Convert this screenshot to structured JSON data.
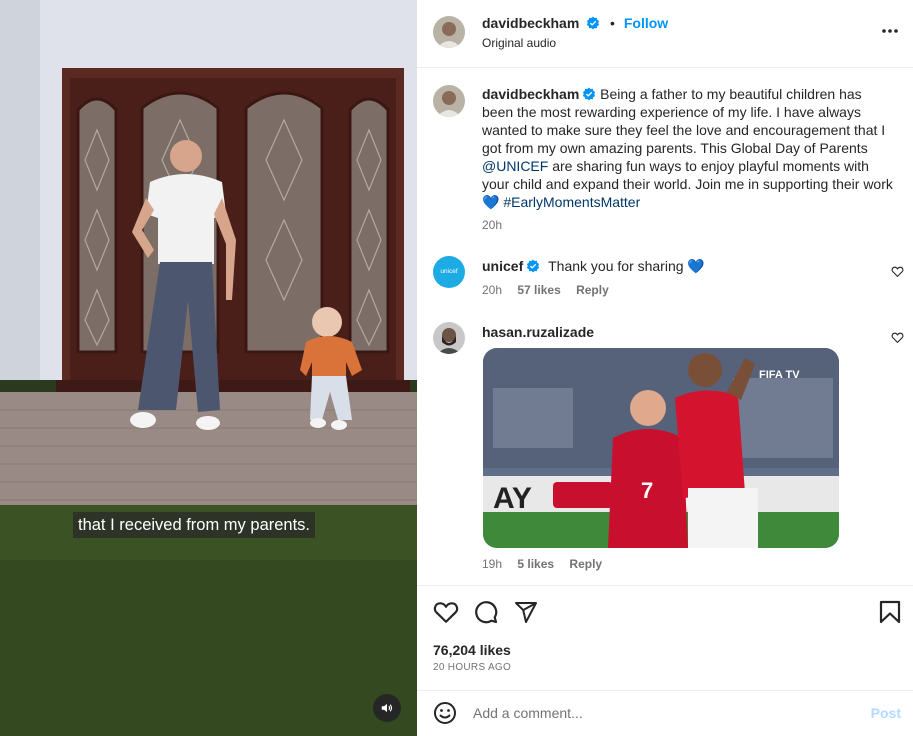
{
  "video": {
    "subtitle": "that I received from my parents.",
    "sound_icon": "speaker-icon"
  },
  "header": {
    "username": "davidbeckham",
    "verified": true,
    "separator": "•",
    "follow_label": "Follow",
    "audio": "Original audio",
    "more_icon": "more-options-icon"
  },
  "caption": {
    "username": "davidbeckham",
    "text_part1": "Being a father to my beautiful children has been the most rewarding experience of my life. I have always wanted to make sure they feel the love and encouragement that I got from my own amazing parents. This Global Day of Parents ",
    "mention": "@UNICEF",
    "text_part2": " are sharing fun ways to enjoy playful moments with your child and expand their world. Join me in supporting their work ",
    "heart_emoji": "💙",
    "hashtag": "#EarlyMomentsMatter",
    "time": "20h"
  },
  "comments": [
    {
      "username": "unicef",
      "verified": true,
      "text": "Thank you for sharing ",
      "emoji": "💙",
      "time": "20h",
      "likes": "57 likes",
      "reply_label": "Reply"
    },
    {
      "username": "hasan.ruzalizade",
      "verified": false,
      "image_watermark": "FIFA TV",
      "time": "19h",
      "likes": "5 likes",
      "reply_label": "Reply"
    }
  ],
  "actions": {
    "like_icon": "heart-icon",
    "comment_icon": "comment-icon",
    "share_icon": "share-icon",
    "save_icon": "bookmark-icon",
    "likes_count": "76,204 likes",
    "time_ago": "20 HOURS AGO"
  },
  "composer": {
    "placeholder": "Add a comment...",
    "post_label": "Post"
  },
  "colors": {
    "link_blue": "#0095f6",
    "verified_blue": "#0095f6",
    "muted": "#737373",
    "post_disabled": "#b3dbff"
  }
}
